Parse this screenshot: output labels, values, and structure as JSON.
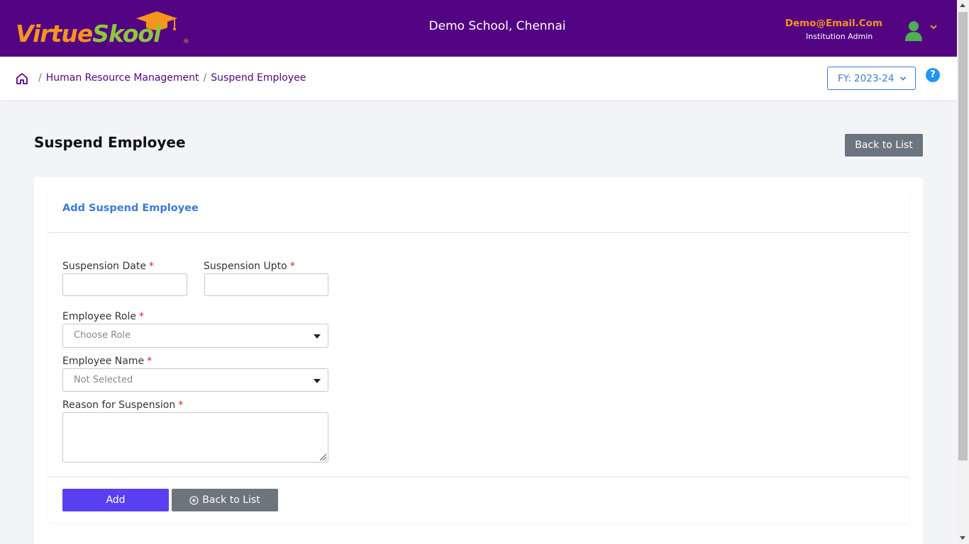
{
  "header": {
    "logo": {
      "part1": "Virtue",
      "part2": "Skool",
      "reg": "®",
      "icon": "graduation-cap-icon"
    },
    "school_name": "Demo School, Chennai",
    "user_email": "Demo@Email.Com",
    "user_role": "Institution Admin",
    "avatar_icon": "user-icon",
    "menu_icon": "chevron-down-icon",
    "colors": {
      "bar": "#520483",
      "accent": "#f7941d",
      "green": "#8dc63f"
    }
  },
  "breadcrumb": {
    "home_icon": "home-icon",
    "items": [
      "Human Resource Management",
      "Suspend Employee"
    ],
    "separator": "/"
  },
  "fy_selector": {
    "value": "FY: 2023-24"
  },
  "help": {
    "label": "?",
    "icon": "help-icon"
  },
  "page": {
    "title": "Suspend Employee",
    "back_label": "Back to List"
  },
  "form": {
    "card_title": "Add Suspend Employee",
    "required_mark": "*",
    "fields": {
      "suspension_date": {
        "label": "Suspension Date",
        "value": ""
      },
      "suspension_upto": {
        "label": "Suspension Upto",
        "value": ""
      },
      "employee_role": {
        "label": "Employee Role",
        "placeholder": "Choose Role"
      },
      "employee_name": {
        "label": "Employee Name",
        "placeholder": "Not Selected"
      },
      "reason": {
        "label": "Reason for Suspension",
        "value": ""
      }
    },
    "add_label": "Add",
    "back_label": "Back to List",
    "back_icon": "arrow-left-circle-icon",
    "colors": {
      "primary": "#5a3ff2",
      "secondary": "#6c757d",
      "title": "#3a7bd5",
      "required": "#e02020"
    }
  }
}
